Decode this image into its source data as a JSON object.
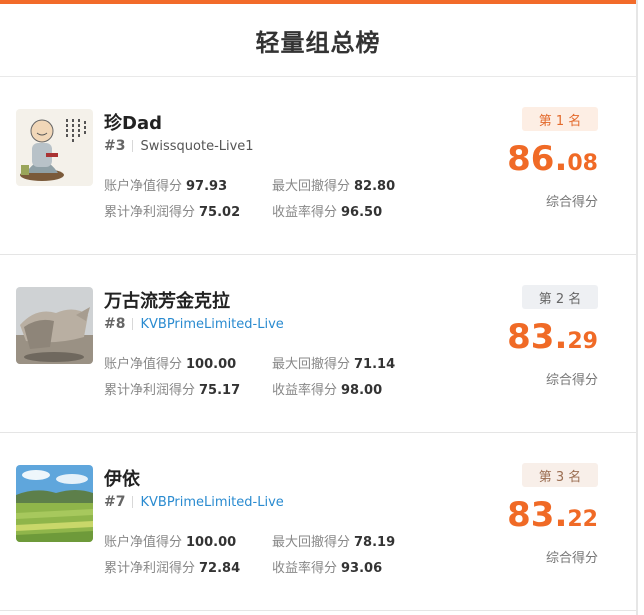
{
  "header": {
    "title": "轻量组总榜"
  },
  "colors": {
    "accent": "#f26b2a",
    "score": "#f06a26",
    "link": "#2a8bd0"
  },
  "entries": [
    {
      "name": "珍Dad",
      "rank_no": "#3",
      "broker": "Swissquote-Live1",
      "stats": [
        {
          "label": "账户净值得分",
          "value": "97.93"
        },
        {
          "label": "最大回撤得分",
          "value": "82.80"
        },
        {
          "label": "累计净利润得分",
          "value": "75.02"
        },
        {
          "label": "收益率得分",
          "value": "96.50"
        }
      ],
      "badge": "第 1 名",
      "score_int": "86",
      "score_dot": ".",
      "score_dec": "08",
      "score_label": "综合得分"
    },
    {
      "name": "万古流芳金克拉",
      "rank_no": "#8",
      "broker": "KVBPrimeLimited-Live",
      "stats": [
        {
          "label": "账户净值得分",
          "value": "100.00"
        },
        {
          "label": "最大回撤得分",
          "value": "71.14"
        },
        {
          "label": "累计净利润得分",
          "value": "75.17"
        },
        {
          "label": "收益率得分",
          "value": "98.00"
        }
      ],
      "badge": "第 2 名",
      "score_int": "83",
      "score_dot": ".",
      "score_dec": "29",
      "score_label": "综合得分"
    },
    {
      "name": "伊依",
      "rank_no": "#7",
      "broker": "KVBPrimeLimited-Live",
      "stats": [
        {
          "label": "账户净值得分",
          "value": "100.00"
        },
        {
          "label": "最大回撤得分",
          "value": "78.19"
        },
        {
          "label": "累计净利润得分",
          "value": "72.84"
        },
        {
          "label": "收益率得分",
          "value": "93.06"
        }
      ],
      "badge": "第 3 名",
      "score_int": "83",
      "score_dot": ".",
      "score_dec": "22",
      "score_label": "综合得分"
    }
  ]
}
